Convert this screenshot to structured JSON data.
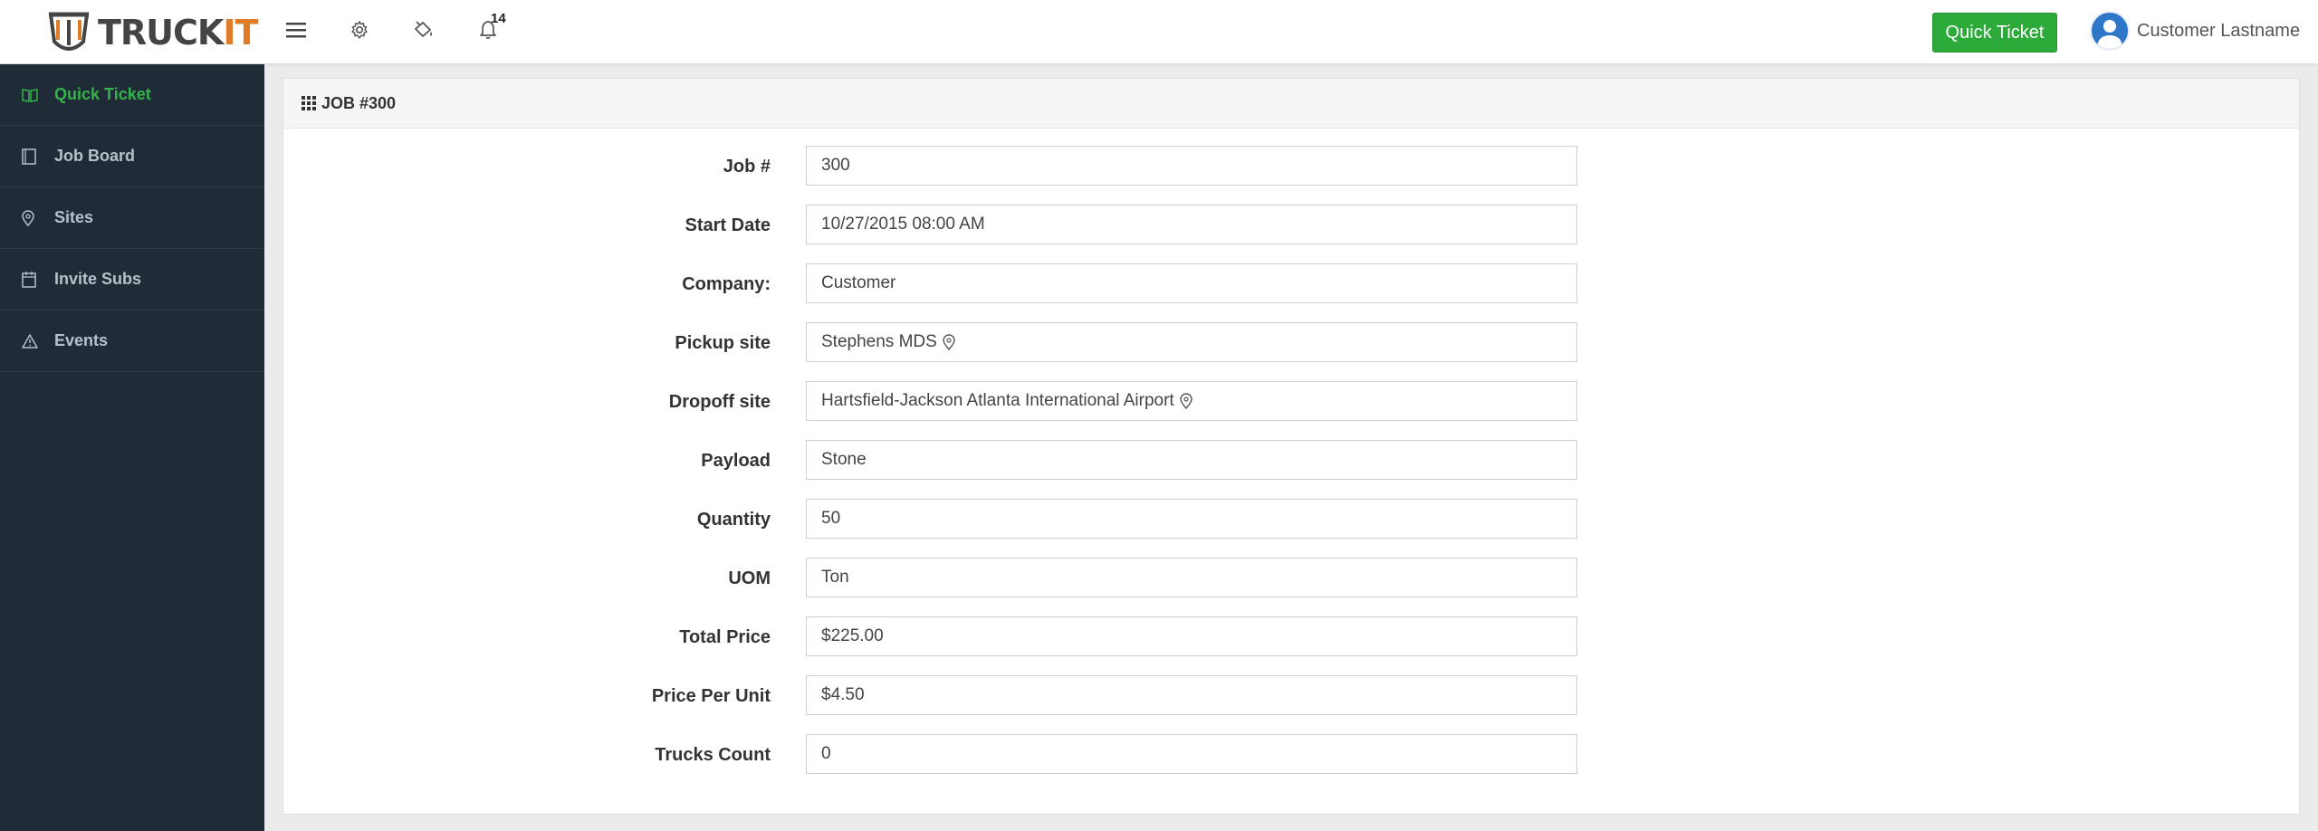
{
  "header": {
    "logo_text_a": "TRUCK",
    "logo_text_b": "IT",
    "notification_count": "14",
    "quick_ticket_label": "Quick Ticket",
    "user_name": "Customer Lastname",
    "icons": [
      "menu-icon",
      "gear-icon",
      "paint-bucket-icon",
      "bell-icon"
    ]
  },
  "sidebar": {
    "items": [
      {
        "label": "Quick Ticket",
        "icon": "book-icon",
        "active": true
      },
      {
        "label": "Job Board",
        "icon": "document-icon",
        "active": false
      },
      {
        "label": "Sites",
        "icon": "map-pin-icon",
        "active": false
      },
      {
        "label": "Invite Subs",
        "icon": "calendar-icon",
        "active": false
      },
      {
        "label": "Events",
        "icon": "warning-icon",
        "active": false
      }
    ]
  },
  "panel": {
    "title": "JOB #300",
    "fields": [
      {
        "label": "Job #",
        "value": "300"
      },
      {
        "label": "Start Date",
        "value": "10/27/2015 08:00 AM"
      },
      {
        "label": "Company:",
        "value": "Customer"
      },
      {
        "label": "Pickup site",
        "value": "Stephens MDS"
      },
      {
        "label": "Dropoff site",
        "value": "Hartsfield-Jackson Atlanta International Airport"
      },
      {
        "label": "Payload",
        "value": "Stone"
      },
      {
        "label": "Quantity",
        "value": "50"
      },
      {
        "label": "UOM",
        "value": "Ton"
      },
      {
        "label": "Total Price",
        "value": "$225.00"
      },
      {
        "label": "Price Per Unit",
        "value": "$4.50"
      },
      {
        "label": "Trucks Count",
        "value": "0"
      }
    ]
  },
  "colors": {
    "accent_green": "#2cab3a",
    "sidebar_bg": "#1f2c38",
    "logo_orange": "#e07b27"
  }
}
